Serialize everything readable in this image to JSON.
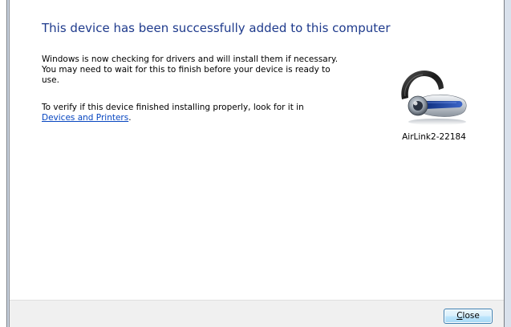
{
  "dialog": {
    "heading": "This device has been successfully added to this computer",
    "paragraph1": "Windows is now checking for drivers and will install them if necessary. You may need to wait for this to finish before your device is ready to use.",
    "paragraph2_prefix": "To verify if this device finished installing properly, look for it in",
    "devices_link": "Devices and Printers",
    "paragraph2_suffix": "."
  },
  "device": {
    "name": "AirLink2-22184",
    "icon": "bluetooth-headset-icon"
  },
  "footer": {
    "close_label": "Close",
    "close_accel_first": "C",
    "close_accel_rest": "lose"
  },
  "colors": {
    "heading": "#1e3a8c",
    "link": "#0645c0",
    "footer_bg": "#f0f0f0"
  }
}
